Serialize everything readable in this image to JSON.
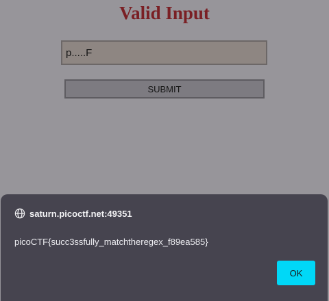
{
  "page": {
    "title": "Valid Input"
  },
  "form": {
    "input_value": "p.....F",
    "submit_label": "SUBMIT"
  },
  "alert": {
    "origin": "saturn.picoctf.net:49351",
    "message": "picoCTF{succ3ssfully_matchtheregex_f89ea585}",
    "ok_label": "OK"
  },
  "icons": {
    "origin": "globe-icon"
  },
  "colors": {
    "page_bg": "#97959a",
    "title": "#7a1f24",
    "dialog_bg": "#46444f",
    "ok_button": "#00d8f7"
  }
}
